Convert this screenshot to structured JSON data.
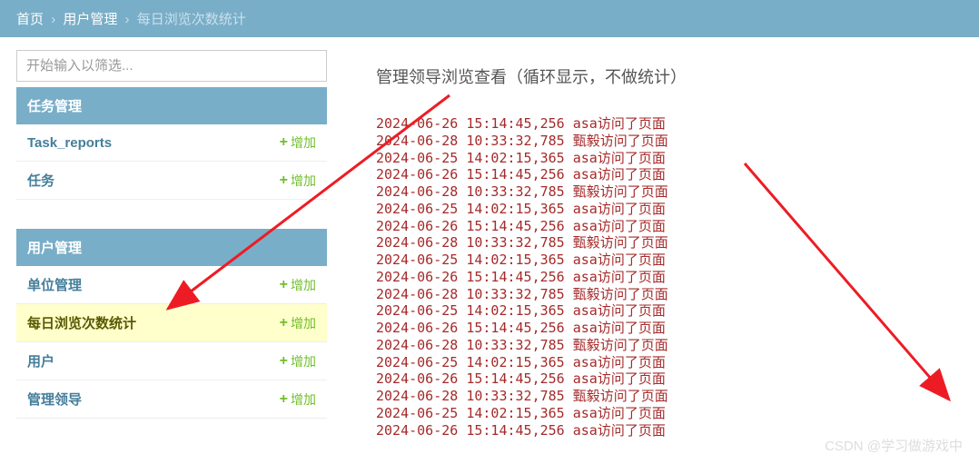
{
  "breadcrumb": {
    "home": "首页",
    "section": "用户管理",
    "current": "每日浏览次数统计"
  },
  "filter": {
    "placeholder": "开始输入以筛选..."
  },
  "sections": [
    {
      "title": "任务管理",
      "models": [
        {
          "name": "Task_reports",
          "add": "增加"
        },
        {
          "name": "任务",
          "add": "增加"
        }
      ]
    },
    {
      "title": "用户管理",
      "models": [
        {
          "name": "单位管理",
          "add": "增加"
        },
        {
          "name": "每日浏览次数统计",
          "add": "增加",
          "active": true
        },
        {
          "name": "用户",
          "add": "增加"
        },
        {
          "name": "管理领导",
          "add": "增加"
        }
      ]
    }
  ],
  "main": {
    "title": "管理领导浏览查看（循环显示，不做统计）",
    "logs": [
      "2024-06-26 15:14:45,256 asa访问了页面",
      "2024-06-28 10:33:32,785 甄毅访问了页面",
      "2024-06-25 14:02:15,365 asa访问了页面",
      "2024-06-26 15:14:45,256 asa访问了页面",
      "2024-06-28 10:33:32,785 甄毅访问了页面",
      "2024-06-25 14:02:15,365 asa访问了页面",
      "2024-06-26 15:14:45,256 asa访问了页面",
      "2024-06-28 10:33:32,785 甄毅访问了页面",
      "2024-06-25 14:02:15,365 asa访问了页面",
      "2024-06-26 15:14:45,256 asa访问了页面",
      "2024-06-28 10:33:32,785 甄毅访问了页面",
      "2024-06-25 14:02:15,365 asa访问了页面",
      "2024-06-26 15:14:45,256 asa访问了页面",
      "2024-06-28 10:33:32,785 甄毅访问了页面",
      "2024-06-25 14:02:15,365 asa访问了页面",
      "2024-06-26 15:14:45,256 asa访问了页面",
      "2024-06-28 10:33:32,785 甄毅访问了页面",
      "2024-06-25 14:02:15,365 asa访问了页面",
      "2024-06-26 15:14:45,256 asa访问了页面"
    ]
  },
  "watermark": "CSDN @学习做游戏中"
}
